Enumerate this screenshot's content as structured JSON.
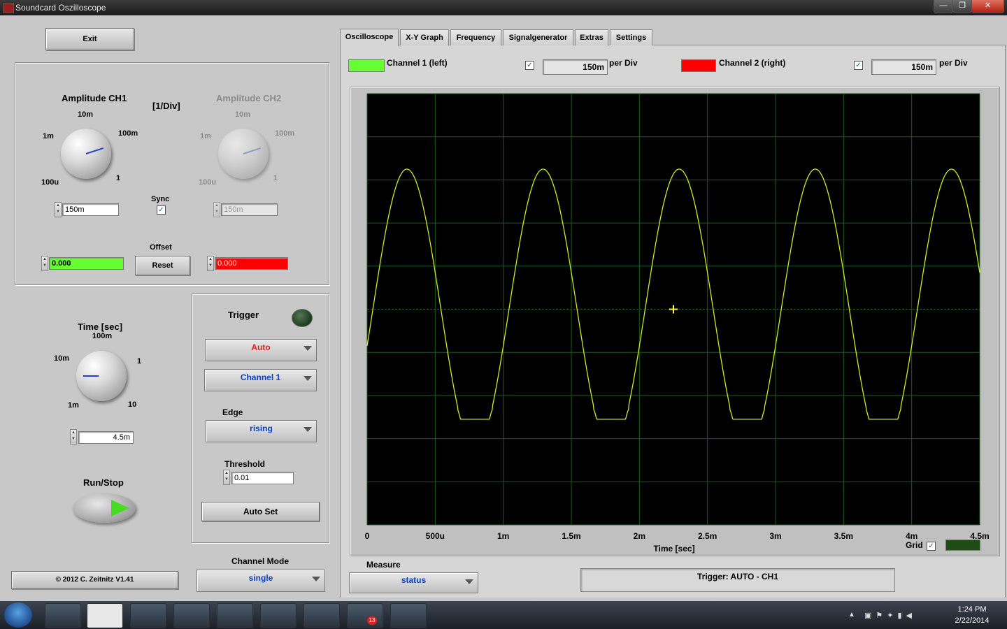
{
  "window": {
    "title": "Soundcard Oszilloscope",
    "min": "—",
    "max": "❐",
    "close": "✕"
  },
  "left": {
    "exit_label": "Exit",
    "amp_ch1": {
      "title": "Amplitude CH1",
      "ticks": [
        "1m",
        "10m",
        "100m",
        "1",
        "100u"
      ],
      "value": "150m"
    },
    "unit_label": "[1/Div]",
    "amp_ch2": {
      "title": "Amplitude CH2",
      "ticks": [
        "1m",
        "10m",
        "100m",
        "1",
        "100u"
      ],
      "value": "150m"
    },
    "sync_label": "Sync",
    "offset_label": "Offset",
    "offset_ch1": "0.000",
    "offset_ch2": "0.000",
    "reset_label": "Reset",
    "time": {
      "title": "Time [sec]",
      "ticks": [
        "10m",
        "100m",
        "1",
        "1m",
        "10"
      ],
      "value": "4.5m"
    },
    "runstop_label": "Run/Stop",
    "copyright": "© 2012  C. Zeitnitz V1.41"
  },
  "trigger": {
    "title": "Trigger",
    "mode": "Auto",
    "channel": "Channel 1",
    "edge_label": "Edge",
    "edge": "rising",
    "threshold_label": "Threshold",
    "threshold": "0.01",
    "autoset_label": "Auto Set"
  },
  "channel_mode": {
    "label": "Channel Mode",
    "value": "single"
  },
  "tabs": [
    "Oscilloscope",
    "X-Y Graph",
    "Frequency",
    "Signalgenerator",
    "Extras",
    "Settings"
  ],
  "channels": {
    "ch1": {
      "label": "Channel 1 (left)",
      "per_div": "150m",
      "color": "#66ff33"
    },
    "ch2": {
      "label": "Channel 2 (right)",
      "per_div": "150m",
      "color": "#ff0000"
    },
    "per_div_label": "per Div"
  },
  "grid": {
    "label": "Grid"
  },
  "measure": {
    "label": "Measure",
    "value": "status"
  },
  "status_text": "Trigger: AUTO - CH1",
  "taskbar": {
    "time": "1:24 PM",
    "date": "2/22/2014",
    "badge": "13"
  },
  "chart_data": {
    "type": "line",
    "xlabel": "Time [sec]",
    "x_ticks": [
      "0",
      "500u",
      "1m",
      "1.5m",
      "2m",
      "2.5m",
      "3m",
      "3.5m",
      "4m",
      "4.5m"
    ],
    "xlim": [
      0,
      0.0045
    ],
    "ylim": [
      -5,
      5
    ],
    "grid": true,
    "series": [
      {
        "color": "#ccee22",
        "waveform": "clipped-sine",
        "frequency_hz": 1000,
        "amplitude_div": 3.25,
        "clip_low_div": -2.55,
        "phase_at_zero_div": -0.85
      }
    ],
    "x_div": 9,
    "y_div": 10
  }
}
